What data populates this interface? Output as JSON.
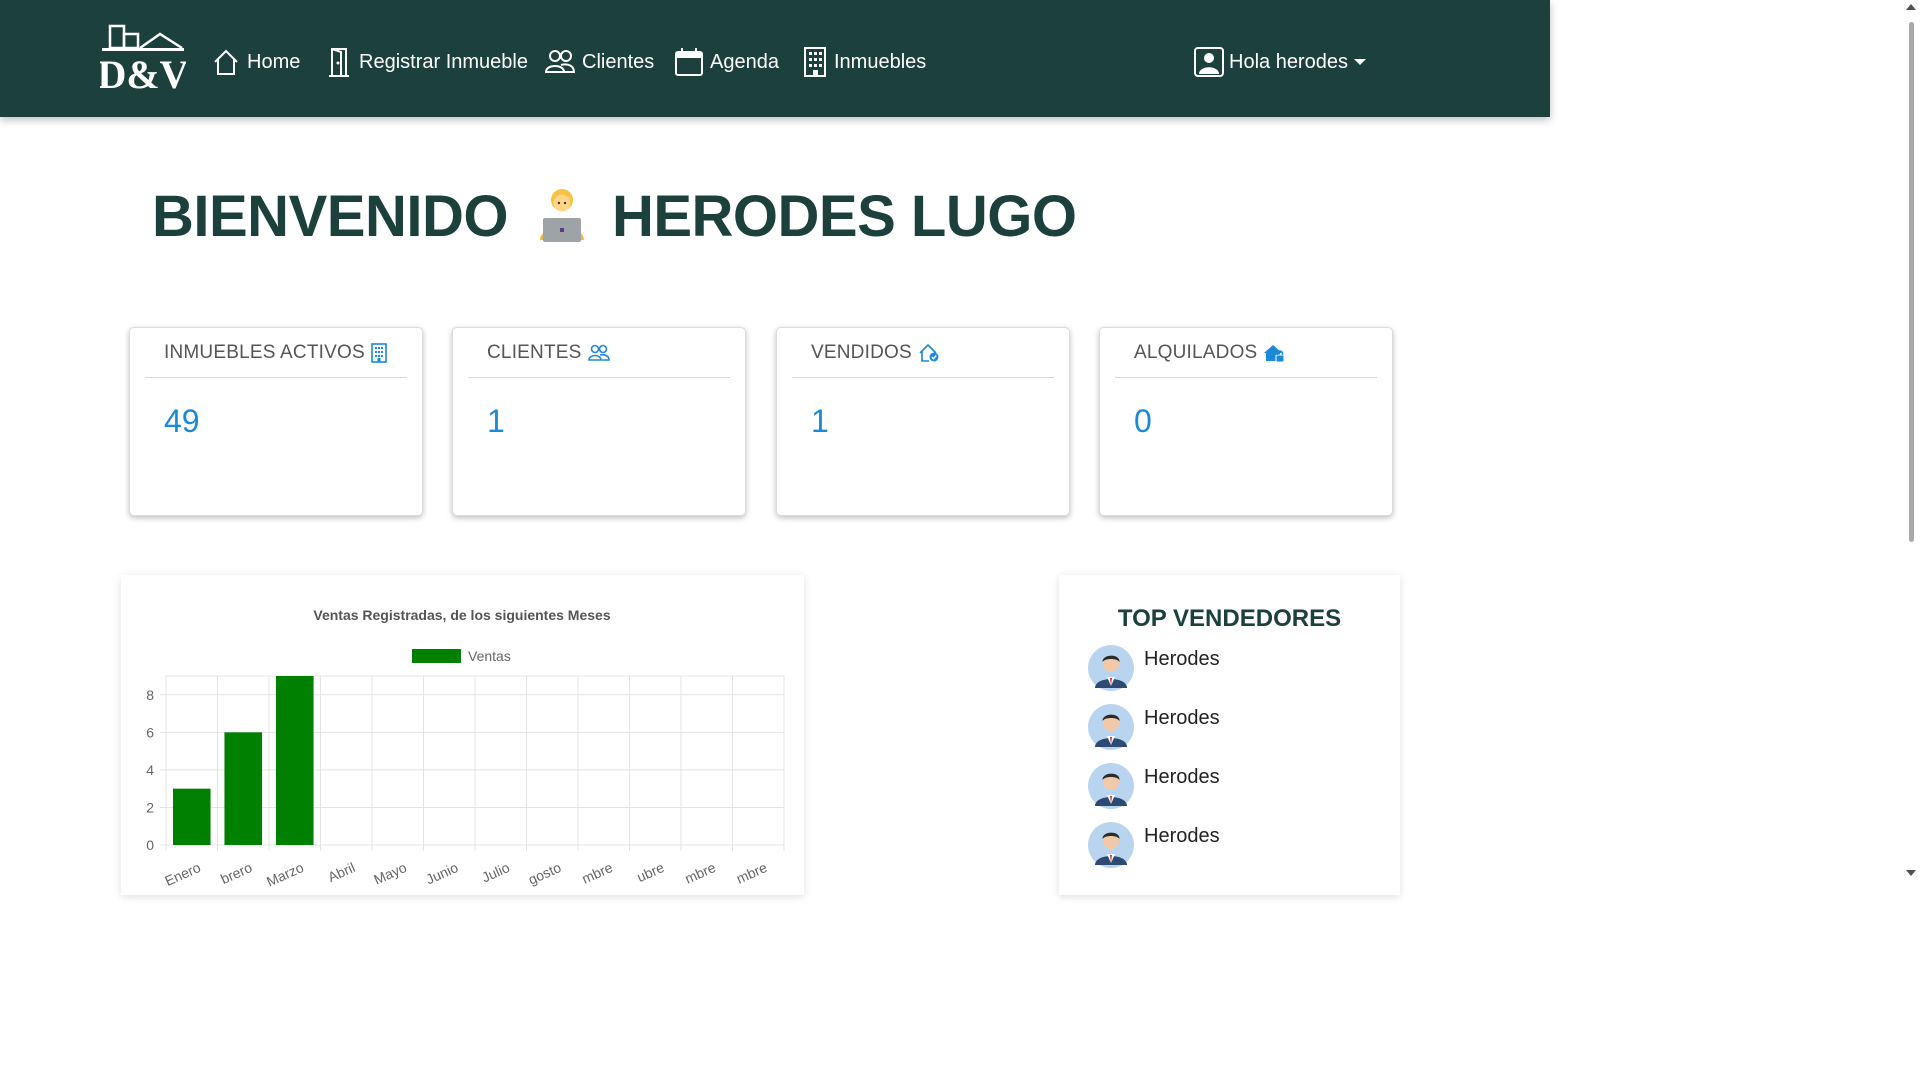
{
  "nav": {
    "logo_text": "D&V",
    "items": [
      {
        "label": "Home",
        "icon": "house-icon"
      },
      {
        "label": "Registrar Inmueble",
        "icon": "door-icon"
      },
      {
        "label": "Clientes",
        "icon": "people-icon"
      },
      {
        "label": "Agenda",
        "icon": "calendar-icon"
      },
      {
        "label": "Inmuebles",
        "icon": "building-icon"
      }
    ],
    "user_label": "Hola herodes",
    "user_icon": "person-square-icon"
  },
  "welcome": {
    "left": "BIENVENIDO",
    "emoji": "🧑‍💻",
    "right": "HERODES LUGO"
  },
  "cards": [
    {
      "title": "INMUEBLES ACTIVOS",
      "value": "49",
      "icon": "building-icon"
    },
    {
      "title": "CLIENTES",
      "value": "1",
      "icon": "people-icon"
    },
    {
      "title": "VENDIDOS",
      "value": "1",
      "icon": "house-check-icon"
    },
    {
      "title": "ALQUILADOS",
      "value": "0",
      "icon": "house-lock-icon"
    }
  ],
  "chart_data": {
    "type": "bar",
    "title": "Ventas Registradas, de los siguientes Meses",
    "series": [
      {
        "name": "Ventas",
        "color": "#008000",
        "values": [
          3,
          6,
          9,
          0,
          0,
          0,
          0,
          0,
          0,
          0,
          0,
          0
        ]
      }
    ],
    "categories": [
      "Enero",
      "Febrero",
      "Marzo",
      "Abril",
      "Mayo",
      "Junio",
      "Julio",
      "Agosto",
      "Septiembre",
      "Octubre",
      "Noviembre",
      "Diciembre"
    ],
    "visible_tick_labels": [
      "Enero",
      "brero",
      "Marzo",
      "Abril",
      "Mayo",
      "Junio",
      "Julio",
      "gosto",
      "mbre",
      "ubre",
      "mbre",
      "mbre"
    ],
    "yticks": [
      0,
      2,
      4,
      6,
      8
    ],
    "ylim": [
      0,
      9
    ],
    "legend": "top-center",
    "grid": true
  },
  "top_sellers": {
    "title": "TOP VENDEDORES",
    "items": [
      {
        "name": "Herodes"
      },
      {
        "name": "Herodes"
      },
      {
        "name": "Herodes"
      },
      {
        "name": "Herodes"
      }
    ]
  },
  "colors": {
    "navbar": "#1c403c",
    "accent_blue": "#1a8ad8",
    "bar_green": "#008000"
  }
}
